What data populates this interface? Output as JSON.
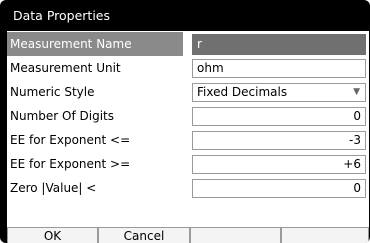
{
  "dialog": {
    "title": "Data Properties"
  },
  "rows": [
    {
      "label": "Measurement Name",
      "value": "r"
    },
    {
      "label": "Measurement Unit",
      "value": "ohm"
    },
    {
      "label": "Numeric Style",
      "value": "Fixed Decimals",
      "icon": "dropdown-arrow-icon"
    },
    {
      "label": "Number Of Digits",
      "value": "0"
    },
    {
      "label": "EE for Exponent <=",
      "value": "-3"
    },
    {
      "label": "EE for Exponent >=",
      "value": "+6"
    },
    {
      "label": "Zero |Value| <",
      "value": "0"
    }
  ],
  "buttons": {
    "ok": "OK",
    "cancel": "Cancel"
  },
  "colors": {
    "selected_label": "#8a8a8a",
    "selected_field": "#707070",
    "frame": "#000000"
  }
}
